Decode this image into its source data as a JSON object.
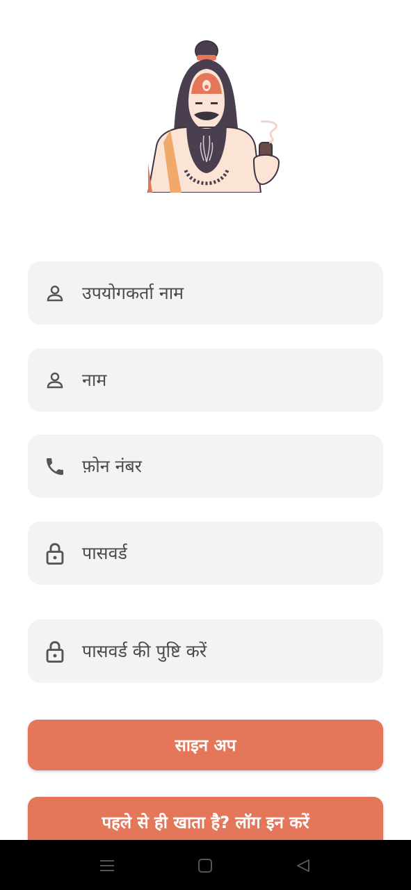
{
  "colors": {
    "accent": "#e4765a",
    "field_bg": "#f3f3f3",
    "icon": "#555555",
    "navbar": "#000000"
  },
  "illustration": {
    "name": "sadhu-illustration"
  },
  "form": {
    "username": {
      "placeholder": "उपयोगकर्ता नाम",
      "icon": "person-icon"
    },
    "name": {
      "placeholder": "नाम",
      "icon": "person-icon"
    },
    "phone": {
      "placeholder": "फ़ोन नंबर",
      "icon": "phone-icon"
    },
    "password": {
      "placeholder": "पासवर्ड",
      "icon": "lock-icon"
    },
    "confirm_password": {
      "placeholder": "पासवर्ड की पुष्टि करें",
      "icon": "lock-icon"
    }
  },
  "buttons": {
    "signup": "साइन अप",
    "login": "पहले से ही खाता है? लॉग इन करें"
  },
  "navbar": {
    "icons": [
      "menu-icon",
      "home-icon",
      "back-icon"
    ]
  }
}
